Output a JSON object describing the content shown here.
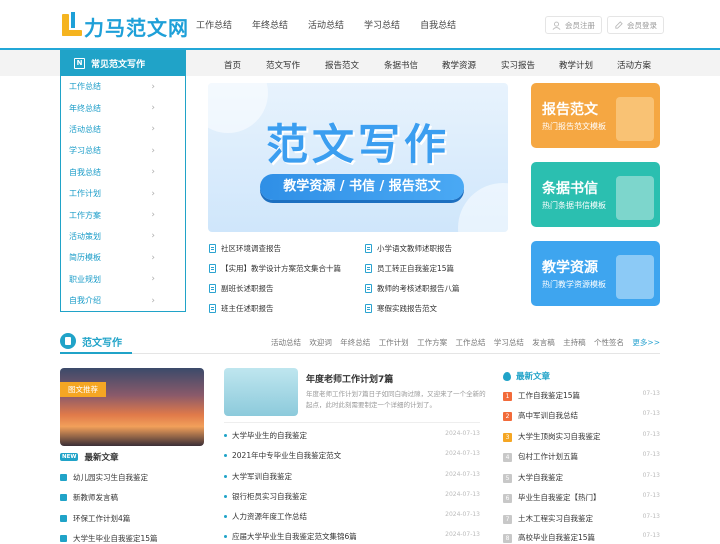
{
  "logo": {
    "text": "力马范文网"
  },
  "topnav": [
    "工作总结",
    "年终总结",
    "活动总结",
    "学习总结",
    "自我总结"
  ],
  "auth": {
    "register": "会员注册",
    "login": "会员登录"
  },
  "nav": {
    "category_title": "常见范文写作",
    "items": [
      "首页",
      "范文写作",
      "报告范文",
      "条据书信",
      "教学资源",
      "实习报告",
      "教学计划",
      "活动方案"
    ]
  },
  "sidebar": [
    "工作总结",
    "年终总结",
    "活动总结",
    "学习总结",
    "自我总结",
    "工作计划",
    "工作方案",
    "活动策划",
    "简历模板",
    "职业规划",
    "自我介绍"
  ],
  "banner": {
    "title": "范文写作",
    "subtitle": "教学资源 / 书信 / 报告范文"
  },
  "promos": [
    {
      "title": "报告范文",
      "sub": "热门报告范文模板",
      "color": "#f5a742"
    },
    {
      "title": "条据书信",
      "sub": "热门条据书信模板",
      "color": "#2bbfb0"
    },
    {
      "title": "教学资源",
      "sub": "热门教学资源模板",
      "color": "#3ea5ef"
    }
  ],
  "hot_links": [
    [
      "社区环境调查报告",
      "小学语文教师述职报告"
    ],
    [
      "【实用】教学设计方案范文集合十篇",
      "员工转正自我鉴定15篇"
    ],
    [
      "副班长述职报告",
      "教师的考核述职报告八篇"
    ],
    [
      "班主任述职报告",
      "寒假实践报告范文"
    ]
  ],
  "section": {
    "title": "范文写作",
    "tags": [
      "活动总结",
      "欢迎词",
      "年终总结",
      "工作计划",
      "工作方案",
      "工作总结",
      "学习总结",
      "发言稿",
      "主持稿",
      "个性签名"
    ],
    "more": "更多>>"
  },
  "left": {
    "photo_tag": "图文推荐",
    "new_badge": "NEW",
    "new_title": "最新文章",
    "items": [
      "幼儿园实习生自我鉴定",
      "新教师发言稿",
      "环保工作计划4篇",
      "大学生毕业自我鉴定15篇"
    ]
  },
  "middle": {
    "feature_title": "年度老师工作计划7篇",
    "feature_desc": "年度老师工作计划7篇日子如同白驹过隙，又迎来了一个全新的起点，此时此刻需要制定一个详细的计划了。",
    "items": [
      {
        "t": "大学毕业生的自我鉴定",
        "d": "2024-07-13"
      },
      {
        "t": "2021年中专毕业生自我鉴定范文",
        "d": "2024-07-13"
      },
      {
        "t": "大学军训自我鉴定",
        "d": "2024-07-13"
      },
      {
        "t": "银行柜员实习自我鉴定",
        "d": "2024-07-13"
      },
      {
        "t": "人力资源年度工作总结",
        "d": "2024-07-13"
      },
      {
        "t": "应届大学毕业生自我鉴定范文集锦6篇",
        "d": "2024-07-13"
      }
    ]
  },
  "right": {
    "title": "最新文章",
    "items": [
      {
        "n": "1",
        "t": "工作自我鉴定15篇",
        "d": "07-13",
        "c": "#f26b3a"
      },
      {
        "n": "2",
        "t": "高中军训自我总结",
        "d": "07-13",
        "c": "#f26b3a"
      },
      {
        "n": "3",
        "t": "大学生顶岗实习自我鉴定",
        "d": "07-13",
        "c": "#f5a623"
      },
      {
        "n": "4",
        "t": "包村工作计划五篇",
        "d": "07-13",
        "c": "#c8c8c8"
      },
      {
        "n": "5",
        "t": "大学自我鉴定",
        "d": "07-13",
        "c": "#c8c8c8"
      },
      {
        "n": "6",
        "t": "毕业生自我鉴定【热门】",
        "d": "07-13",
        "c": "#c8c8c8"
      },
      {
        "n": "7",
        "t": "土木工程实习自我鉴定",
        "d": "07-13",
        "c": "#c8c8c8"
      },
      {
        "n": "8",
        "t": "高校毕业自我鉴定15篇",
        "d": "07-13",
        "c": "#c8c8c8"
      }
    ]
  }
}
